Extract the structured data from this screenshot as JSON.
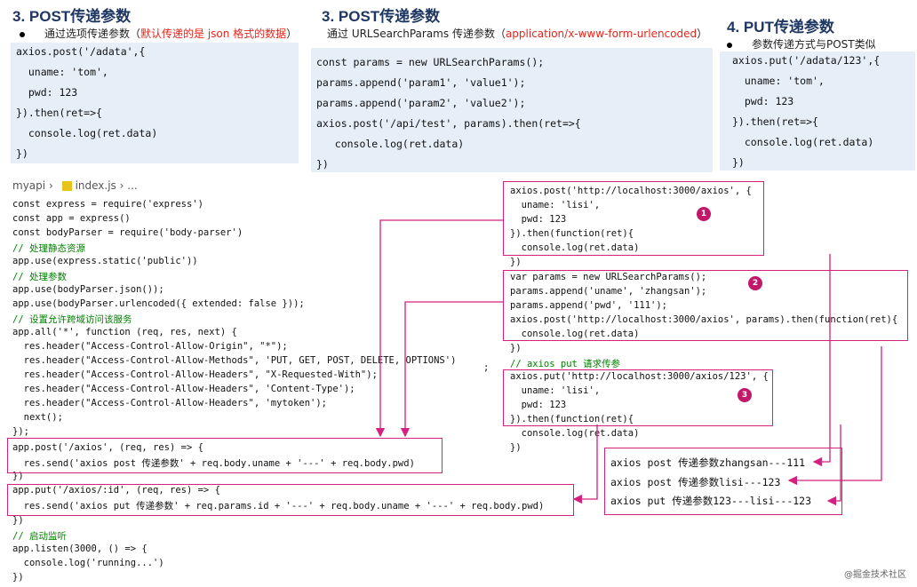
{
  "sections": [
    {
      "heading": "3. POST传递参数",
      "bullet_prefix": "通过选项传递参数（",
      "bullet_red": "默认传递的是 json 格式的数据",
      "bullet_suffix": "）",
      "code": [
        "axios.post('/adata',{",
        "  uname: 'tom',",
        "  pwd: 123",
        "}).then(ret=>{",
        "  console.log(ret.data)",
        "})"
      ]
    },
    {
      "heading": "3. POST传递参数",
      "bullet_prefix": "通过 URLSearchParams 传递参数（",
      "bullet_red": "application/x-www-form-urlencoded",
      "bullet_suffix": "）",
      "code": [
        "const params = new URLSearchParams();",
        "params.append('param1', 'value1');",
        "params.append('param2', 'value2');",
        "axios.post('/api/test', params).then(ret=>{",
        "   console.log(ret.data)",
        "})"
      ]
    },
    {
      "heading": "4. PUT传递参数",
      "bullet_text": "参数传递方式与POST类似",
      "code": [
        "axios.put('/adata/123',{",
        "  uname: 'tom',",
        "  pwd: 123",
        "}).then(ret=>{",
        "  console.log(ret.data)",
        "})"
      ]
    }
  ],
  "breadcrumb": {
    "folder": "myapi",
    "file": "index.js",
    "more": "..."
  },
  "server_code": [
    "const express = require('express')",
    "const app = express()",
    "const bodyParser = require('body-parser')",
    "// 处理静态资源",
    "app.use(express.static('public'))",
    "// 处理参数",
    "app.use(bodyParser.json());",
    "app.use(bodyParser.urlencoded({ extended: false }));",
    "// 设置允许跨域访问该服务",
    "app.all('*', function (req, res, next) {",
    "  res.header(\"Access-Control-Allow-Origin\", \"*\");",
    "  res.header(\"Access-Control-Allow-Methods\", 'PUT, GET, POST, DELETE, OPTIONS')",
    "  res.header(\"Access-Control-Allow-Headers\", \"X-Requested-With\");",
    "  res.header(\"Access-Control-Allow-Headers\", 'Content-Type');",
    "  res.header(\"Access-Control-Allow-Headers\", 'mytoken');",
    "  next();",
    "});",
    "app.post('/axios', (req, res) => {",
    "  res.send('axios post 传递参数' + req.body.uname + '---' + req.body.pwd)",
    "})",
    "app.put('/axios/:id', (req, res) => {",
    "  res.send('axios put 传递参数' + req.params.id + '---' + req.body.uname + '---' + req.body.pwd)",
    "})",
    "// 启动监听",
    "app.listen(3000, () => {",
    "  console.log('running...')",
    "})"
  ],
  "stray_semicolon": ";",
  "client_code": [
    "axios.post('http://localhost:3000/axios', {",
    "  uname: 'lisi',",
    "  pwd: 123",
    "}).then(function(ret){",
    "  console.log(ret.data)",
    "})",
    "var params = new URLSearchParams();",
    "params.append('uname', 'zhangsan');",
    "params.append('pwd', '111');",
    "axios.post('http://localhost:3000/axios', params).then(function(ret){",
    "  console.log(ret.data)",
    "})",
    "// axios put 请求传参",
    "axios.put('http://localhost:3000/axios/123', {",
    "  uname: 'lisi',",
    "  pwd: 123",
    "}).then(function(ret){",
    "  console.log(ret.data)",
    "})"
  ],
  "badges": [
    "1",
    "2",
    "3"
  ],
  "output": [
    "axios post 传递参数zhangsan---111",
    "axios post 传递参数lisi---123",
    "axios put 传递参数123---lisi---123"
  ],
  "watermark": "@掘金技术社区",
  "colors": {
    "highlight_border": "#d4207e",
    "badge": "#c2186b",
    "code_bg": "#e6eef8",
    "heading": "#1f3763",
    "red_text": "#e8261c"
  }
}
